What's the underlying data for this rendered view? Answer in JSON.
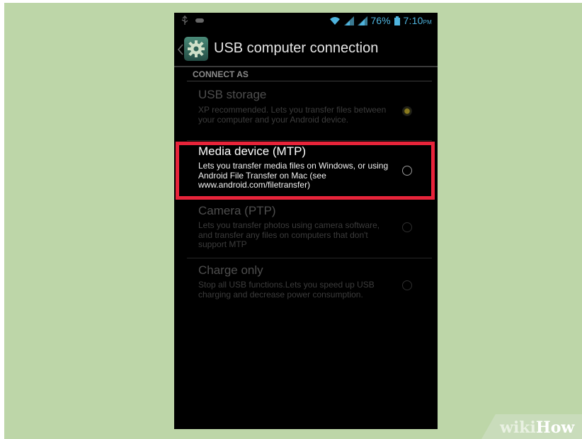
{
  "status_bar": {
    "battery_percent": "76%",
    "time": "7:10",
    "time_suffix": "PM"
  },
  "action_bar": {
    "title": "USB computer connection"
  },
  "section": {
    "label": "CONNECT AS"
  },
  "options": [
    {
      "title": "USB storage",
      "description": "XP recommended. Lets you transfer files between your computer and your Android device.",
      "selected": true
    },
    {
      "title": "Media device (MTP)",
      "description": "Lets you transfer media files on Windows, or using Android File Transfer on Mac (see www.android.com/filetransfer)",
      "selected": false
    },
    {
      "title": "Camera (PTP)",
      "description": "Lets you transfer photos using camera software, and transfer any files on computers that don't support MTP",
      "selected": false
    },
    {
      "title": "Charge only",
      "description": "Stop all USB functions.Lets you speed up USB charging and decrease power consumption.",
      "selected": false
    }
  ],
  "watermark": {
    "wiki": "wiki",
    "how": "How"
  },
  "colors": {
    "highlight": "#e8243a",
    "accent": "#4fb4de",
    "background": "#bdd6a8"
  }
}
